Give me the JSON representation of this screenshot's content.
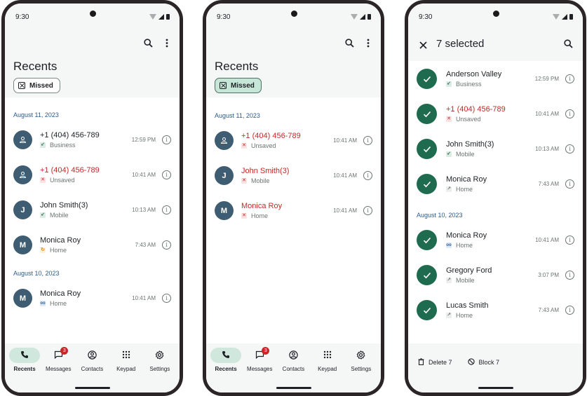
{
  "status": {
    "time": "9:30"
  },
  "screen1": {
    "title": "Recents",
    "filter": "Missed",
    "sections": [
      {
        "date": "August 11, 2023",
        "rows": [
          {
            "avatar": "person-icon",
            "name": "+1 (404) 456-789",
            "missed": false,
            "icon": "incoming-call-icon",
            "icon_glyph": "↙",
            "icon_class": "ic-inc",
            "type": "Business",
            "time": "12:59 PM"
          },
          {
            "avatar": "person-icon",
            "name": "+1 (404) 456-789",
            "missed": true,
            "icon": "missed-call-icon",
            "icon_glyph": "✕",
            "icon_class": "ic-miss",
            "type": "Unsaved",
            "time": "10:41 AM"
          },
          {
            "avatar": "J",
            "name": "John Smith(3)",
            "missed": false,
            "icon": "incoming-call-icon",
            "icon_glyph": "↙",
            "icon_class": "ic-inc",
            "type": "Mobile",
            "time": "10:13 AM"
          },
          {
            "avatar": "M",
            "name": "Monica Roy",
            "missed": false,
            "icon": "forwarded-call-icon",
            "icon_glyph": "↻",
            "icon_class": "ic-orange",
            "type": "Home",
            "time": "7:43 AM"
          }
        ]
      },
      {
        "date": "August 10, 2023",
        "rows": [
          {
            "avatar": "M",
            "name": "Monica Roy",
            "missed": false,
            "icon": "voicemail-icon",
            "icon_glyph": "oo",
            "icon_class": "ic-vm",
            "type": "Home",
            "time": "10:41 AM"
          }
        ]
      }
    ]
  },
  "screen2": {
    "title": "Recents",
    "filter": "Missed",
    "sections": [
      {
        "date": "August 11, 2023",
        "rows": [
          {
            "avatar": "person-icon",
            "name": "+1 (404) 456-789",
            "missed": true,
            "icon": "missed-call-icon",
            "icon_glyph": "✕",
            "icon_class": "ic-miss",
            "type": "Unsaved",
            "time": "10:41 AM"
          },
          {
            "avatar": "J",
            "name": "John Smith(3)",
            "missed": true,
            "icon": "missed-call-icon",
            "icon_glyph": "✕",
            "icon_class": "ic-miss",
            "type": "Mobile",
            "time": "10:41 AM"
          },
          {
            "avatar": "M",
            "name": "Monica Roy",
            "missed": true,
            "icon": "missed-call-icon",
            "icon_glyph": "✕",
            "icon_class": "ic-miss",
            "type": "Home",
            "time": "10:41 AM"
          }
        ]
      }
    ]
  },
  "screen3": {
    "selected_title": "7 selected",
    "sections": [
      {
        "date": "",
        "rows": [
          {
            "avatar": "check",
            "name": "Anderson Valley",
            "missed": false,
            "icon": "incoming-call-icon",
            "icon_glyph": "↙",
            "icon_class": "ic-inc",
            "type": "Business",
            "time": "12:59 PM"
          },
          {
            "avatar": "check",
            "name": "+1 (404) 456-789",
            "missed": true,
            "icon": "missed-call-icon",
            "icon_glyph": "✕",
            "icon_class": "ic-miss",
            "type": "Unsaved",
            "time": "10:41 AM"
          },
          {
            "avatar": "check",
            "name": "John Smith(3)",
            "missed": false,
            "icon": "incoming-call-icon",
            "icon_glyph": "↙",
            "icon_class": "ic-inc",
            "type": "Mobile",
            "time": "10:13 AM"
          },
          {
            "avatar": "check",
            "name": "Monica Roy",
            "missed": false,
            "icon": "outgoing-call-icon",
            "icon_glyph": "↗",
            "icon_class": "ic-out",
            "type": "Home",
            "time": "7:43 AM"
          }
        ]
      },
      {
        "date": "August 10, 2023",
        "rows": [
          {
            "avatar": "check",
            "name": "Monica Roy",
            "missed": false,
            "icon": "voicemail-icon",
            "icon_glyph": "oo",
            "icon_class": "ic-vm",
            "type": "Home",
            "time": "10:41 AM"
          },
          {
            "avatar": "check",
            "name": "Gregory Ford",
            "missed": false,
            "icon": "outgoing-call-icon",
            "icon_glyph": "↗",
            "icon_class": "ic-out",
            "type": "Mobile",
            "time": "3:07 PM"
          },
          {
            "avatar": "check",
            "name": "Lucas Smith",
            "missed": false,
            "icon": "outgoing-call-icon",
            "icon_glyph": "↗",
            "icon_class": "ic-out",
            "type": "Home",
            "time": "7:43 AM"
          }
        ]
      }
    ],
    "actions": {
      "delete": "Delete 7",
      "block": "Block 7"
    }
  },
  "nav": {
    "items": [
      {
        "key": "recents",
        "label": "Recents",
        "icon": "phone-icon"
      },
      {
        "key": "messages",
        "label": "Messages",
        "icon": "message-icon",
        "badge": "3"
      },
      {
        "key": "contacts",
        "label": "Contacts",
        "icon": "contacts-icon"
      },
      {
        "key": "keypad",
        "label": "Keypad",
        "icon": "keypad-icon"
      },
      {
        "key": "settings",
        "label": "Settings",
        "icon": "settings-icon"
      }
    ]
  },
  "colors": {
    "accent": "#1f6b4f",
    "missed": "#c62828",
    "avatar": "#3f5d72",
    "date_header": "#2b5a8a",
    "active_pill": "#cfe7dc"
  }
}
